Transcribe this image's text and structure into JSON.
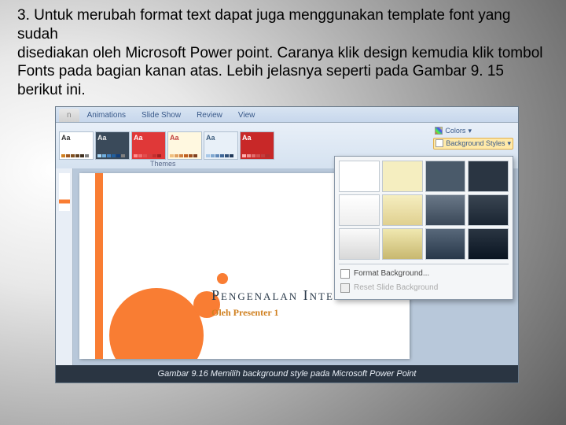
{
  "instruction": {
    "line1": "3. Untuk merubah format text dapat juga menggunakan template font yang sudah",
    "line2": "disediakan oleh Microsoft Power point. Caranya klik design kemudia klik tombol",
    "line3": "Fonts pada bagian kanan atas. Lebih jelasnya seperti pada Gambar 9. 15 berikut ini."
  },
  "ribbon": {
    "tabs": [
      "Animations",
      "Slide Show",
      "Review",
      "View"
    ],
    "themes_label": "Themes",
    "theme_aa": "Aa",
    "right": {
      "colors": "Colors",
      "bgstyles": "Background Styles"
    }
  },
  "popup": {
    "format_bg": "Format Background...",
    "reset_bg": "Reset Slide Background"
  },
  "slide": {
    "title": "Pengenalan Internet",
    "subtitle": "Oleh Presenter 1"
  },
  "caption": "Gambar 9.16 Memilih background style pada Microsoft Power Point",
  "style_colors": [
    [
      "#ffffff",
      "#f5eec0",
      "#4a5a6a",
      "#2a3542"
    ],
    [
      "linear-gradient(#fff,#eee)",
      "linear-gradient(#f5eec0,#e0d090)",
      "linear-gradient(#6a7888,#3a4858)",
      "linear-gradient(#3a4552,#1a2532)"
    ],
    [
      "linear-gradient(#fafafa,#d8d8d8)",
      "linear-gradient(#f0e8b0,#c8b870)",
      "linear-gradient(#58687a,#28384a)",
      "linear-gradient(#2a3542,#0a1522)"
    ]
  ],
  "theme_thumbs": [
    {
      "bg": "#ffffff",
      "aa": "#333",
      "bars": [
        "#d08020",
        "#a05820",
        "#805020",
        "#604020",
        "#403020",
        "#808080"
      ]
    },
    {
      "bg": "#3a4a5a",
      "aa": "#eee",
      "bars": [
        "#a8d8f8",
        "#70b0e0",
        "#4080c0",
        "#2060a0",
        "#104080",
        "#808080"
      ]
    },
    {
      "bg": "#e03838",
      "aa": "#fff",
      "bars": [
        "#ff9090",
        "#f07070",
        "#e05050",
        "#d04040",
        "#c03030",
        "#a02020"
      ]
    },
    {
      "bg": "#fff8e0",
      "aa": "#c04040",
      "bars": [
        "#f0c080",
        "#e0a060",
        "#d08040",
        "#c06020",
        "#a05020",
        "#804020"
      ]
    },
    {
      "bg": "#e8f0f8",
      "aa": "#406080",
      "bars": [
        "#a8c8e8",
        "#80a8d0",
        "#6088b8",
        "#406898",
        "#305078",
        "#203858"
      ]
    },
    {
      "bg": "#c82828",
      "aa": "#fff",
      "bars": [
        "#ffb0b0",
        "#f09090",
        "#e07070",
        "#d05050",
        "#c04040",
        "#b03030"
      ]
    }
  ]
}
